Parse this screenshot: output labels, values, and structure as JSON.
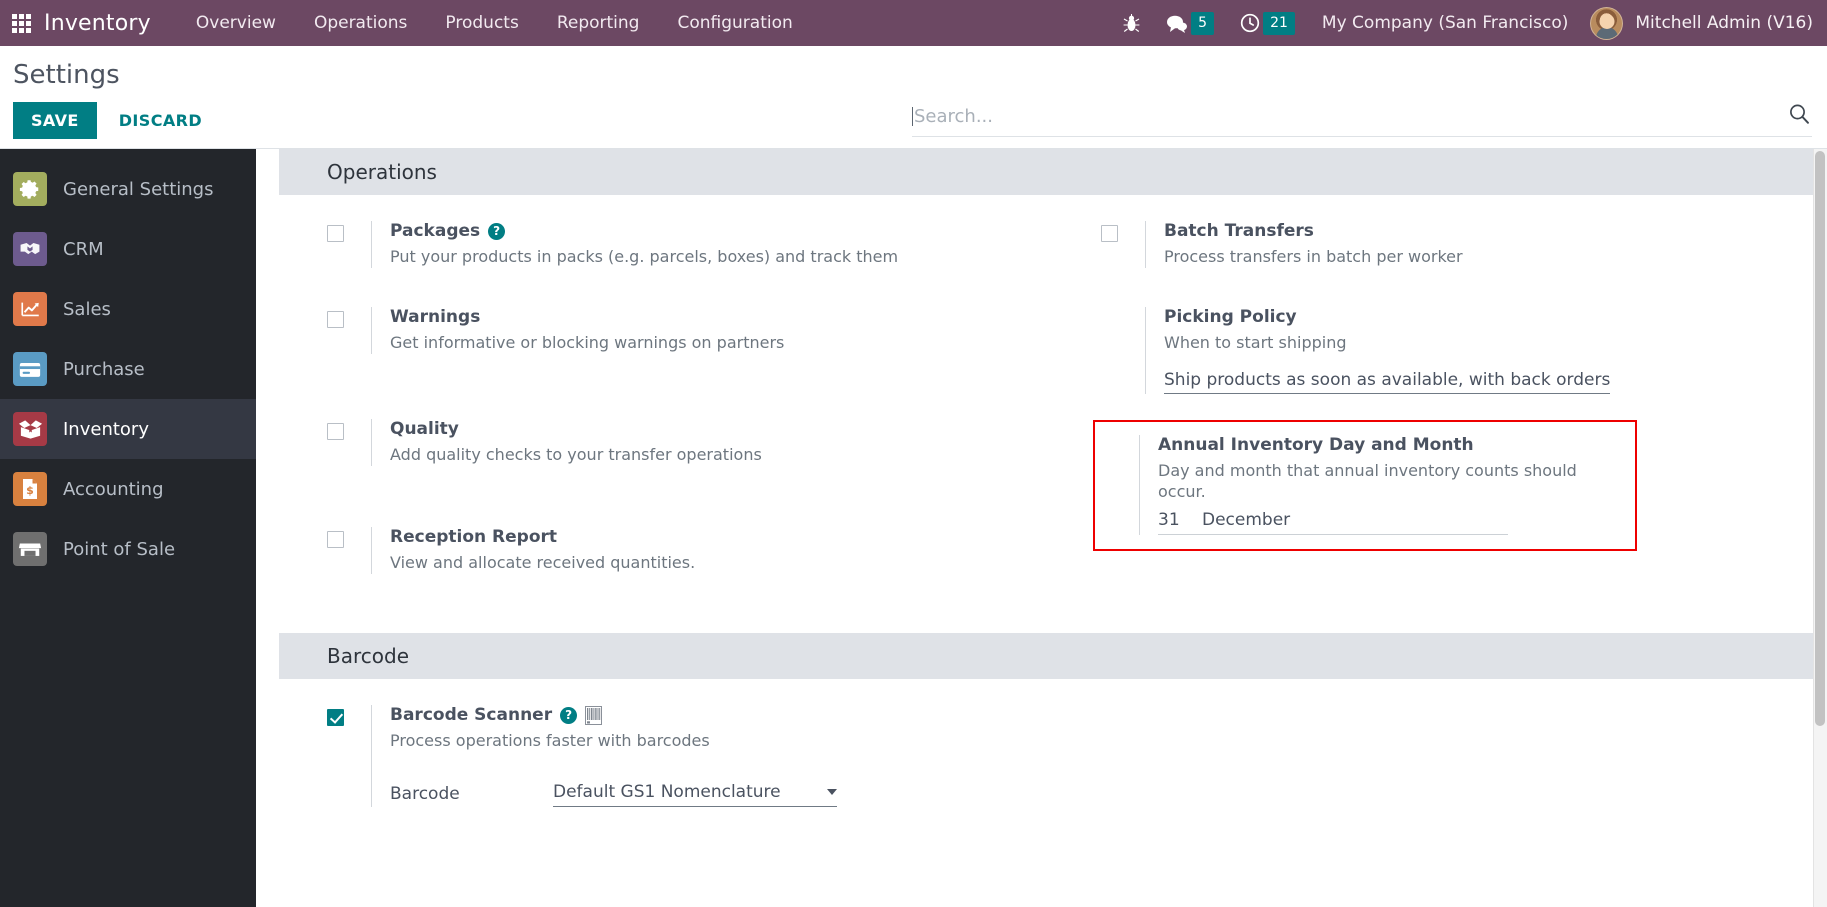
{
  "navbar": {
    "apps_icon": "apps-grid-icon",
    "brand": "Inventory",
    "menus": [
      {
        "label": "Overview"
      },
      {
        "label": "Operations"
      },
      {
        "label": "Products"
      },
      {
        "label": "Reporting"
      },
      {
        "label": "Configuration"
      }
    ],
    "sys": {
      "bug_icon": "bug-icon",
      "messages_icon": "chat-bubble-icon",
      "messages_count": "5",
      "activities_icon": "clock-icon",
      "activities_count": "21"
    },
    "company": "My Company (San Francisco)",
    "user": "Mitchell Admin (V16)"
  },
  "control": {
    "title": "Settings",
    "save_label": "SAVE",
    "discard_label": "DISCARD"
  },
  "search": {
    "placeholder": "Search...",
    "value": "",
    "icon": "magnifier-icon"
  },
  "sidebar": {
    "items": [
      {
        "label": "General Settings",
        "icon": "gear-icon",
        "color": "#a3ad5e",
        "active": false
      },
      {
        "label": "CRM",
        "icon": "handshake-icon",
        "color": "#6d5b8e",
        "active": false
      },
      {
        "label": "Sales",
        "icon": "chart-arrow-icon",
        "color": "#e0794a",
        "active": false
      },
      {
        "label": "Purchase",
        "icon": "card-icon",
        "color": "#5a9bc4",
        "active": false
      },
      {
        "label": "Inventory",
        "icon": "open-box-icon",
        "color": "#a63a46",
        "active": true
      },
      {
        "label": "Accounting",
        "icon": "invoice-dollar-icon",
        "color": "#d8813f",
        "active": false
      },
      {
        "label": "Point of Sale",
        "icon": "storefront-icon",
        "color": "#6f6f6f",
        "active": false
      }
    ]
  },
  "sections": [
    {
      "title": "Operations",
      "left": [
        {
          "name": "packages",
          "checkbox": true,
          "checked": false,
          "title": "Packages",
          "help": "?",
          "desc": "Put your products in packs (e.g. parcels, boxes) and track them"
        },
        {
          "name": "warnings",
          "checkbox": true,
          "checked": false,
          "title": "Warnings",
          "desc": "Get informative or blocking warnings on partners"
        },
        {
          "name": "quality",
          "checkbox": true,
          "checked": false,
          "title": "Quality",
          "desc": "Add quality checks to your transfer operations"
        },
        {
          "name": "reception-report",
          "checkbox": true,
          "checked": false,
          "title": "Reception Report",
          "desc": "View and allocate received quantities."
        }
      ],
      "right": [
        {
          "name": "batch-transfers",
          "checkbox": true,
          "checked": false,
          "title": "Batch Transfers",
          "desc": "Process transfers in batch per worker"
        },
        {
          "name": "picking-policy",
          "checkbox": false,
          "title": "Picking Policy",
          "desc": "When to start shipping",
          "select_value": "Ship products as soon as available, with back orders"
        },
        {
          "name": "annual-inventory-day-and-month",
          "checkbox": false,
          "highlighted": true,
          "highlight_color": "#ee0000",
          "title": "Annual Inventory Day and Month",
          "desc": "Day and month that annual inventory counts should occur.",
          "day_value": "31",
          "month_value": "December"
        }
      ]
    },
    {
      "title": "Barcode",
      "left": [
        {
          "name": "barcode-scanner",
          "checkbox": true,
          "checked": true,
          "title": "Barcode Scanner",
          "help": "?",
          "barcode_icon": "barcode-grid-icon",
          "desc": "Process operations faster with barcodes",
          "field_label": "Barcode",
          "field_value": "Default GS1 Nomenclature"
        }
      ],
      "right": []
    }
  ],
  "scrollbar": {
    "name": "vertical-scrollbar"
  }
}
